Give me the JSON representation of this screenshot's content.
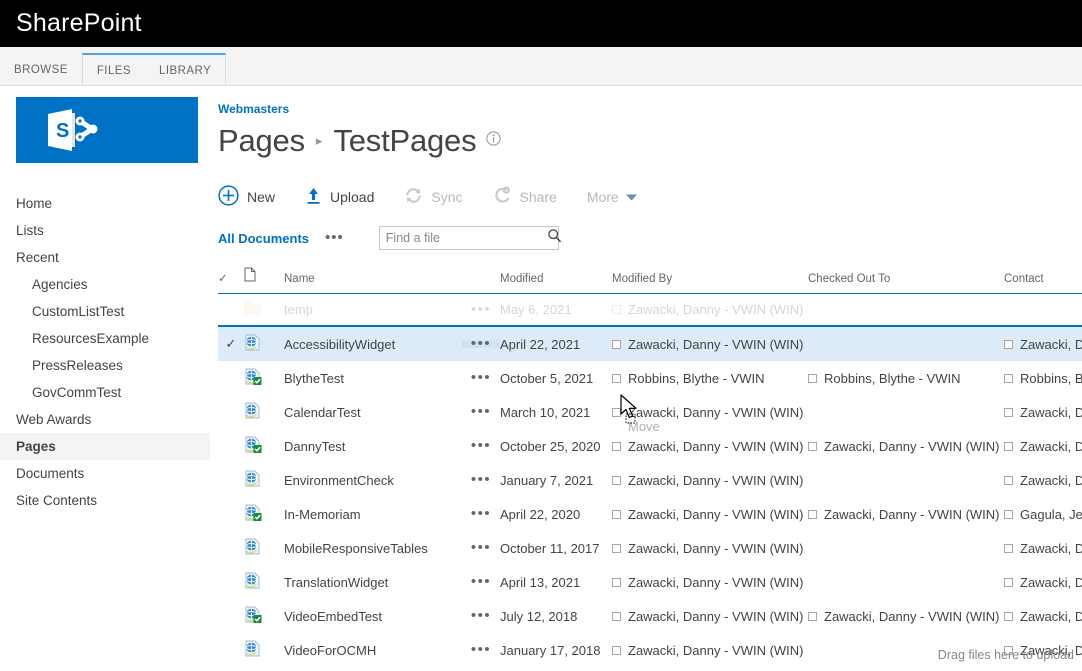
{
  "suite": {
    "title": "SharePoint"
  },
  "ribbon": {
    "tabs": [
      {
        "label": "BROWSE",
        "grouped": false
      },
      {
        "label": "FILES",
        "grouped": true
      },
      {
        "label": "LIBRARY",
        "grouped": true
      }
    ]
  },
  "sidebar": {
    "logo_alt": "sharepoint-logo",
    "items": [
      {
        "label": "Home",
        "level": 0,
        "selected": false
      },
      {
        "label": "Lists",
        "level": 0,
        "selected": false
      },
      {
        "label": "Recent",
        "level": 0,
        "selected": false
      },
      {
        "label": "Agencies",
        "level": 1,
        "selected": false
      },
      {
        "label": "CustomListTest",
        "level": 1,
        "selected": false
      },
      {
        "label": "ResourcesExample",
        "level": 1,
        "selected": false
      },
      {
        "label": "PressReleases",
        "level": 1,
        "selected": false
      },
      {
        "label": "GovCommTest",
        "level": 1,
        "selected": false
      },
      {
        "label": "Web Awards",
        "level": 0,
        "selected": false
      },
      {
        "label": "Pages",
        "level": 0,
        "selected": true
      },
      {
        "label": "Documents",
        "level": 0,
        "selected": false
      },
      {
        "label": "Site Contents",
        "level": 0,
        "selected": false
      }
    ]
  },
  "header": {
    "breadcrumb": "Webmasters",
    "title_parent": "Pages",
    "title_separator": "▸",
    "title_current": "TestPages",
    "info_icon": "info-icon"
  },
  "commands": [
    {
      "label": "New",
      "icon": "plus-circle-icon",
      "disabled": false
    },
    {
      "label": "Upload",
      "icon": "upload-arrow-icon",
      "disabled": false
    },
    {
      "label": "Sync",
      "icon": "sync-icon",
      "disabled": true
    },
    {
      "label": "Share",
      "icon": "share-icon",
      "disabled": true
    },
    {
      "label": "More",
      "icon": "chevron-down-icon",
      "disabled": true
    }
  ],
  "view": {
    "name": "All Documents",
    "ellipsis": "•••"
  },
  "search": {
    "placeholder": "Find a file",
    "value": "",
    "icon": "search-icon"
  },
  "table": {
    "columns": [
      {
        "key": "select",
        "label": "✓"
      },
      {
        "key": "type",
        "label": "document-type-icon"
      },
      {
        "key": "name",
        "label": "Name"
      },
      {
        "key": "modified",
        "label": "Modified"
      },
      {
        "key": "modified_by",
        "label": "Modified By"
      },
      {
        "key": "checked_out_to",
        "label": "Checked Out To"
      },
      {
        "key": "contact",
        "label": "Contact"
      }
    ],
    "ellipsis": "•••",
    "rows": [
      {
        "name": "temp",
        "icon": "folder-icon",
        "badge": false,
        "modified": "May 6, 2021",
        "modified_by": "Zawacki, Danny - VWIN (WIN)",
        "checked_out_to": "",
        "contact": "",
        "selected": false,
        "state": "dragging"
      },
      {
        "name": "AccessibilityWidget",
        "icon": "aspx-page-icon",
        "badge": false,
        "modified": "April 22, 2021",
        "modified_by": "Zawacki, Danny - VWIN (WIN)",
        "checked_out_to": "",
        "contact": "Zawacki, Da",
        "selected": true,
        "state": "selected"
      },
      {
        "name": "BlytheTest",
        "icon": "aspx-page-icon",
        "badge": true,
        "modified": "October 5, 2021",
        "modified_by": "Robbins, Blythe - VWIN",
        "checked_out_to": "Robbins, Blythe - VWIN",
        "contact": "Robbins, Bly",
        "selected": false,
        "state": "normal"
      },
      {
        "name": "CalendarTest",
        "icon": "aspx-page-icon",
        "badge": false,
        "modified": "March 10, 2021",
        "modified_by": "Zawacki, Danny - VWIN (WIN)",
        "checked_out_to": "",
        "contact": "Zawacki, Da",
        "selected": false,
        "state": "normal"
      },
      {
        "name": "DannyTest",
        "icon": "aspx-page-icon",
        "badge": true,
        "modified": "October 25, 2020",
        "modified_by": "Zawacki, Danny - VWIN (WIN)",
        "checked_out_to": "Zawacki, Danny - VWIN (WIN)",
        "contact": "Zawacki, Da",
        "selected": false,
        "state": "normal"
      },
      {
        "name": "EnvironmentCheck",
        "icon": "aspx-page-icon",
        "badge": false,
        "modified": "January 7, 2021",
        "modified_by": "Zawacki, Danny - VWIN (WIN)",
        "checked_out_to": "",
        "contact": "Zawacki, Da",
        "selected": false,
        "state": "normal"
      },
      {
        "name": "In-Memoriam",
        "icon": "aspx-page-icon",
        "badge": true,
        "modified": "April 22, 2020",
        "modified_by": "Zawacki, Danny - VWIN (WIN)",
        "checked_out_to": "Zawacki, Danny - VWIN (WIN)",
        "contact": "Gagula, Jele",
        "selected": false,
        "state": "normal"
      },
      {
        "name": "MobileResponsiveTables",
        "icon": "aspx-page-icon",
        "badge": false,
        "modified": "October 11, 2017",
        "modified_by": "Zawacki, Danny - VWIN (WIN)",
        "checked_out_to": "",
        "contact": "Zawacki, Da",
        "selected": false,
        "state": "normal"
      },
      {
        "name": "TranslationWidget",
        "icon": "aspx-page-icon",
        "badge": false,
        "modified": "April 13, 2021",
        "modified_by": "Zawacki, Danny - VWIN (WIN)",
        "checked_out_to": "",
        "contact": "Zawacki, Da",
        "selected": false,
        "state": "normal"
      },
      {
        "name": "VideoEmbedTest",
        "icon": "aspx-page-icon",
        "badge": true,
        "modified": "July 12, 2018",
        "modified_by": "Zawacki, Danny - VWIN (WIN)",
        "checked_out_to": "Zawacki, Danny - VWIN (WIN)",
        "contact": "Zawacki, Da",
        "selected": false,
        "state": "normal"
      },
      {
        "name": "VideoForOCMH",
        "icon": "aspx-page-icon",
        "badge": false,
        "modified": "January 17, 2018",
        "modified_by": "Zawacki, Danny - VWIN (WIN)",
        "checked_out_to": "",
        "contact": "Zawacki, Da",
        "selected": false,
        "state": "normal"
      }
    ]
  },
  "drag": {
    "label": "Move",
    "cursor": "drag-move-cursor"
  },
  "footer": {
    "drag_hint": "Drag files here to upload"
  },
  "colors": {
    "suite_bg": "#000000",
    "accent": "#0072c6",
    "selected_row": "#dcebf7",
    "ribbon_bg": "#f4f4f4",
    "text": "#444444",
    "muted": "#666666",
    "disabled": "#b9b9b9"
  }
}
